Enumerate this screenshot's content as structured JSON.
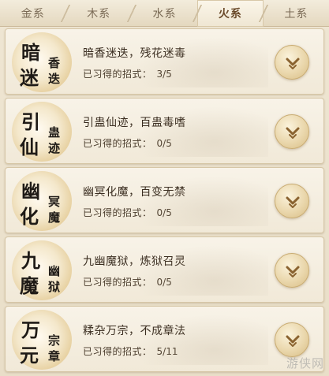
{
  "tabs": [
    {
      "label": "金系",
      "active": false
    },
    {
      "label": "木系",
      "active": false
    },
    {
      "label": "水系",
      "active": false
    },
    {
      "label": "火系",
      "active": true
    },
    {
      "label": "土系",
      "active": false
    }
  ],
  "progress_label": "已习得的招式：",
  "skills": [
    {
      "badge": [
        "暗",
        "迷",
        "香",
        "迭"
      ],
      "title": "暗香迷迭，残花迷毒",
      "progress": "3/5",
      "learned": 3,
      "total": 5
    },
    {
      "badge": [
        "引",
        "仙",
        "蛊",
        "迹"
      ],
      "title": "引蛊仙迹，百蛊毒嗜",
      "progress": "0/5",
      "learned": 0,
      "total": 5
    },
    {
      "badge": [
        "幽",
        "化",
        "冥",
        "魔"
      ],
      "title": "幽冥化魔，百变无禁",
      "progress": "0/5",
      "learned": 0,
      "total": 5
    },
    {
      "badge": [
        "九",
        "魔",
        "幽",
        "狱"
      ],
      "title": "九幽魔狱，炼狱召灵",
      "progress": "0/5",
      "learned": 0,
      "total": 5
    },
    {
      "badge": [
        "万",
        "元",
        "宗",
        "章"
      ],
      "title": "糅杂万宗，不成章法",
      "progress": "5/11",
      "learned": 5,
      "total": 11
    }
  ],
  "watermark": "游侠网",
  "icons": {
    "expand": "chevron-down-icon"
  },
  "colors": {
    "accent": "#6a4a2a",
    "card_bg": "#f6f0e2",
    "toggle_gold": "#e0c690"
  }
}
